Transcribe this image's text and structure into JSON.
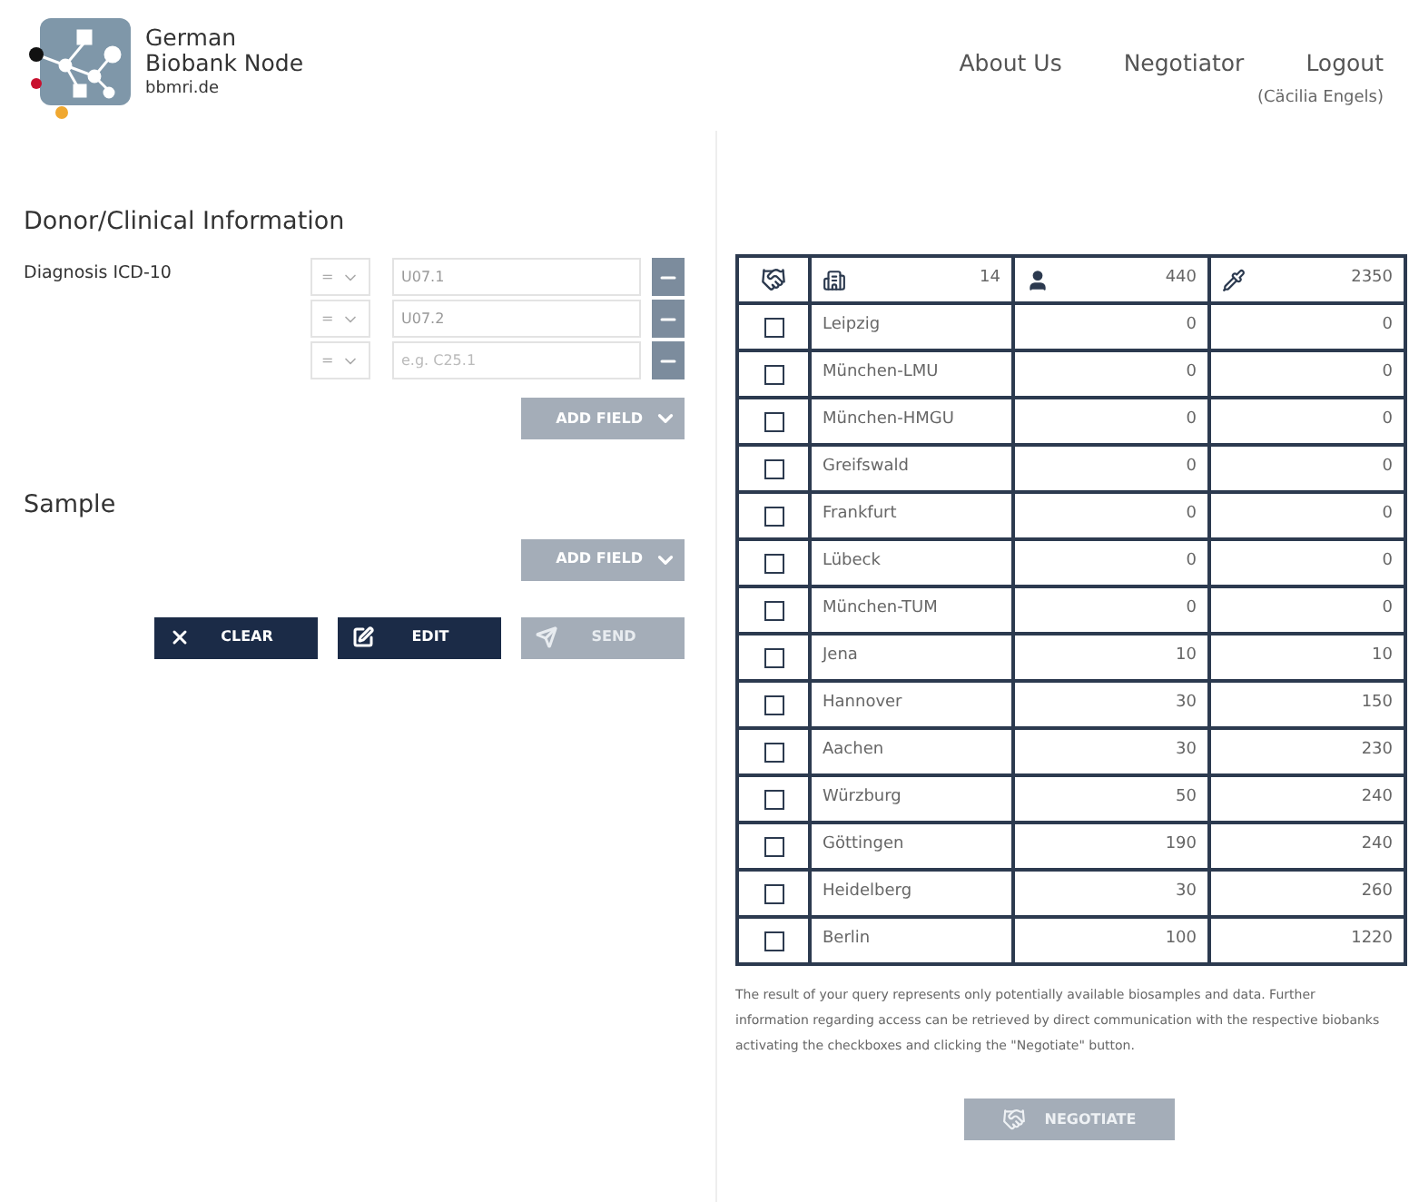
{
  "logo": {
    "title_line_1": "German",
    "title_line_2": "Biobank Node",
    "subtitle": "bbmri.de"
  },
  "nav": [
    {
      "label": "About Us"
    },
    {
      "label": "Negotiator"
    },
    {
      "label": "Logout"
    }
  ],
  "user": "(Cäcilia Engels)",
  "sections": [
    {
      "title": "Donor/Clinical Information",
      "fields": [
        {
          "label": "Diagnosis ICD-10",
          "criteria": [
            {
              "operator": "=",
              "value": "U07.1"
            },
            {
              "operator": "=",
              "value": "U07.2"
            },
            {
              "operator": "=",
              "placeholder": "e.g. C25.1"
            }
          ]
        }
      ],
      "add_button": "ADD FIELD"
    },
    {
      "title": "Sample",
      "add_button": "ADD FIELD"
    }
  ],
  "actions": [
    {
      "label": "CLEAR",
      "kind": "clear",
      "disabled": false
    },
    {
      "label": "EDIT",
      "kind": "edit",
      "disabled": false
    },
    {
      "label": "SEND",
      "kind": "send",
      "disabled": true
    }
  ],
  "table": {
    "totals": {
      "biobanks": "14",
      "donors": "440",
      "samples": "2350"
    },
    "rows": [
      {
        "name": "Leipzig",
        "donors": "0",
        "samples": "0",
        "checked": false
      },
      {
        "name": "München-LMU",
        "donors": "0",
        "samples": "0",
        "checked": false
      },
      {
        "name": "München-HMGU",
        "donors": "0",
        "samples": "0",
        "checked": false
      },
      {
        "name": "Greifswald",
        "donors": "0",
        "samples": "0",
        "checked": false
      },
      {
        "name": "Frankfurt",
        "donors": "0",
        "samples": "0",
        "checked": false
      },
      {
        "name": "Lübeck",
        "donors": "0",
        "samples": "0",
        "checked": false
      },
      {
        "name": "München-TUM",
        "donors": "0",
        "samples": "0",
        "checked": false
      },
      {
        "name": "Jena",
        "donors": "10",
        "samples": "10",
        "checked": false
      },
      {
        "name": "Hannover",
        "donors": "30",
        "samples": "150",
        "checked": false
      },
      {
        "name": "Aachen",
        "donors": "30",
        "samples": "230",
        "checked": false
      },
      {
        "name": "Würzburg",
        "donors": "50",
        "samples": "240",
        "checked": false
      },
      {
        "name": "Göttingen",
        "donors": "190",
        "samples": "240",
        "checked": false
      },
      {
        "name": "Heidelberg",
        "donors": "30",
        "samples": "260",
        "checked": false
      },
      {
        "name": "Berlin",
        "donors": "100",
        "samples": "1220",
        "checked": false
      }
    ]
  },
  "notice": "The result of your query represents only potentially available biosamples and data. Further information regarding access can be retrieved by direct communication with the respective biobanks activating the checkboxes and clicking the \"Negotiate\" button.",
  "negotiate_button": {
    "label": "NEGOTIATE",
    "disabled": true
  }
}
